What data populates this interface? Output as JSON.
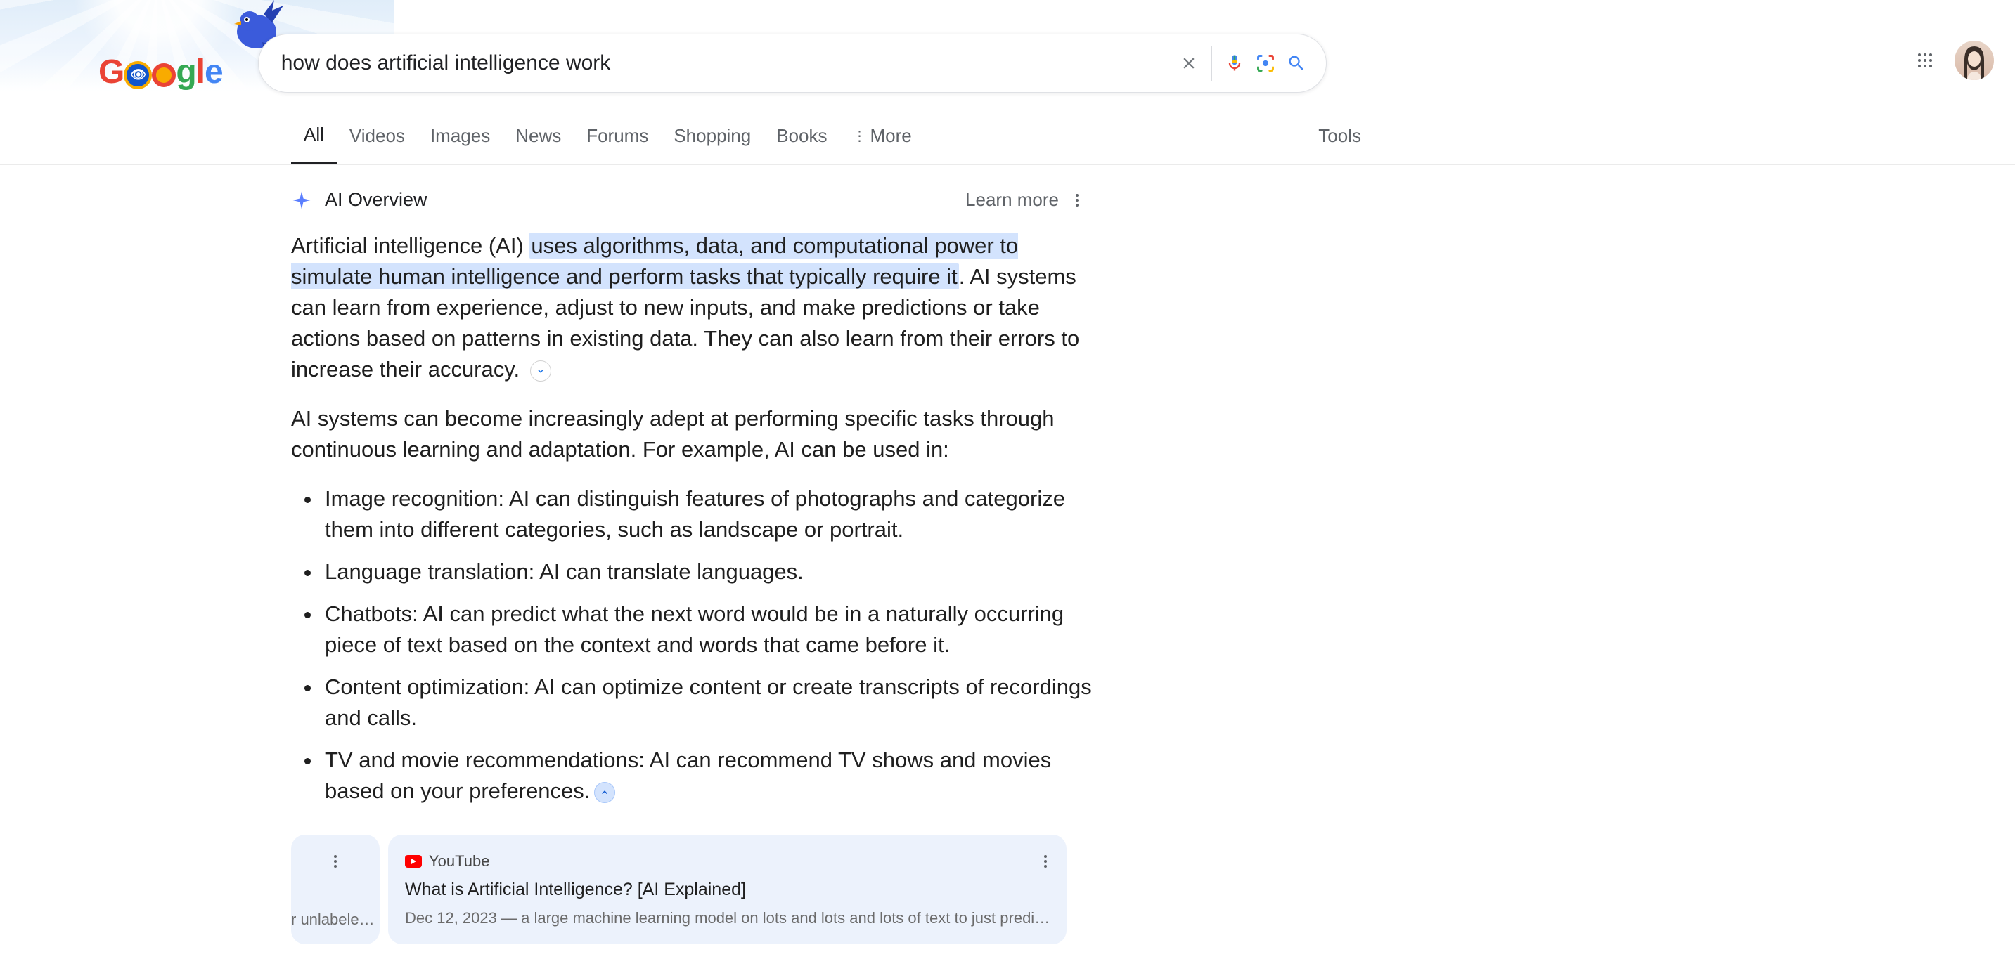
{
  "search": {
    "query": "how does artificial intelligence work"
  },
  "tabs": {
    "all": "All",
    "videos": "Videos",
    "images": "Images",
    "news": "News",
    "forums": "Forums",
    "shopping": "Shopping",
    "books": "Books",
    "more": "More",
    "tools": "Tools"
  },
  "ai": {
    "title": "AI Overview",
    "learn_more": "Learn more",
    "para1_lead": "Artificial intelligence (AI) ",
    "para1_highlight": "uses algorithms, data, and computational power to simulate human intelligence and perform tasks that typically require it",
    "para1_tail": ". AI systems can learn from experience, adjust to new inputs, and make predictions or take actions based on patterns in existing data. They can also learn from their errors to increase their accuracy. ",
    "para2": "AI systems can become increasingly adept at performing specific tasks through continuous learning and adaptation. For example, AI can be used in:",
    "bullets": [
      "Image recognition: AI can distinguish features of photographs and categorize them into different categories, such as landscape or portrait.",
      "Language translation: AI can translate languages.",
      "Chatbots: AI can predict what the next word would be in a naturally occurring piece of text based on the context and words that came before it.",
      "Content optimization: AI can optimize content or create transcripts of recordings and calls.",
      "TV and movie recommendations: AI can recommend TV shows and movies based on your preferences."
    ]
  },
  "cards": {
    "frag": "r unlabele…",
    "source": "YouTube",
    "title": "What is Artificial Intelligence? [AI Explained]",
    "meta": "Dec 12, 2023 — a large machine learning model on lots and lots and lots of text to just predi…"
  }
}
